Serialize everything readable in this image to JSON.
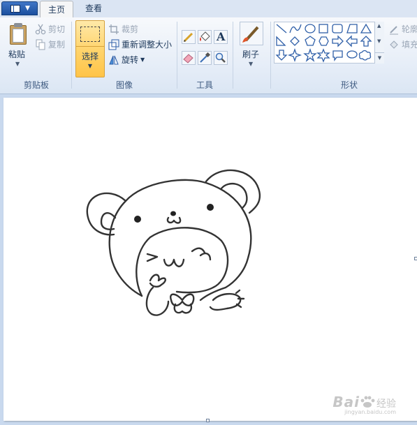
{
  "tabs": [
    {
      "label": "主页",
      "active": true
    },
    {
      "label": "查看",
      "active": false
    }
  ],
  "clipboard": {
    "paste_label": "粘贴",
    "cut_label": "剪切",
    "copy_label": "复制",
    "group_label": "剪贴板"
  },
  "image": {
    "select_label": "选择",
    "crop_label": "裁剪",
    "resize_label": "重新调整大小",
    "rotate_label": "旋转",
    "group_label": "图像"
  },
  "tools": {
    "group_label": "工具",
    "items": [
      "pencil-icon",
      "fill-icon",
      "text-icon",
      "eraser-icon",
      "color-picker-icon",
      "magnifier-icon"
    ]
  },
  "brushes": {
    "label": "刷子"
  },
  "shapes": {
    "group_label": "形状",
    "outline_label": "轮廓",
    "fill_label": "填充"
  },
  "watermark": {
    "logo": "Bai",
    "cn": "经验",
    "url": "jingyan.baidu.com"
  },
  "colors": {
    "accent": "#ffd36a",
    "ribbon": "#e4ecf7",
    "workspace": "#c9d9ee"
  }
}
